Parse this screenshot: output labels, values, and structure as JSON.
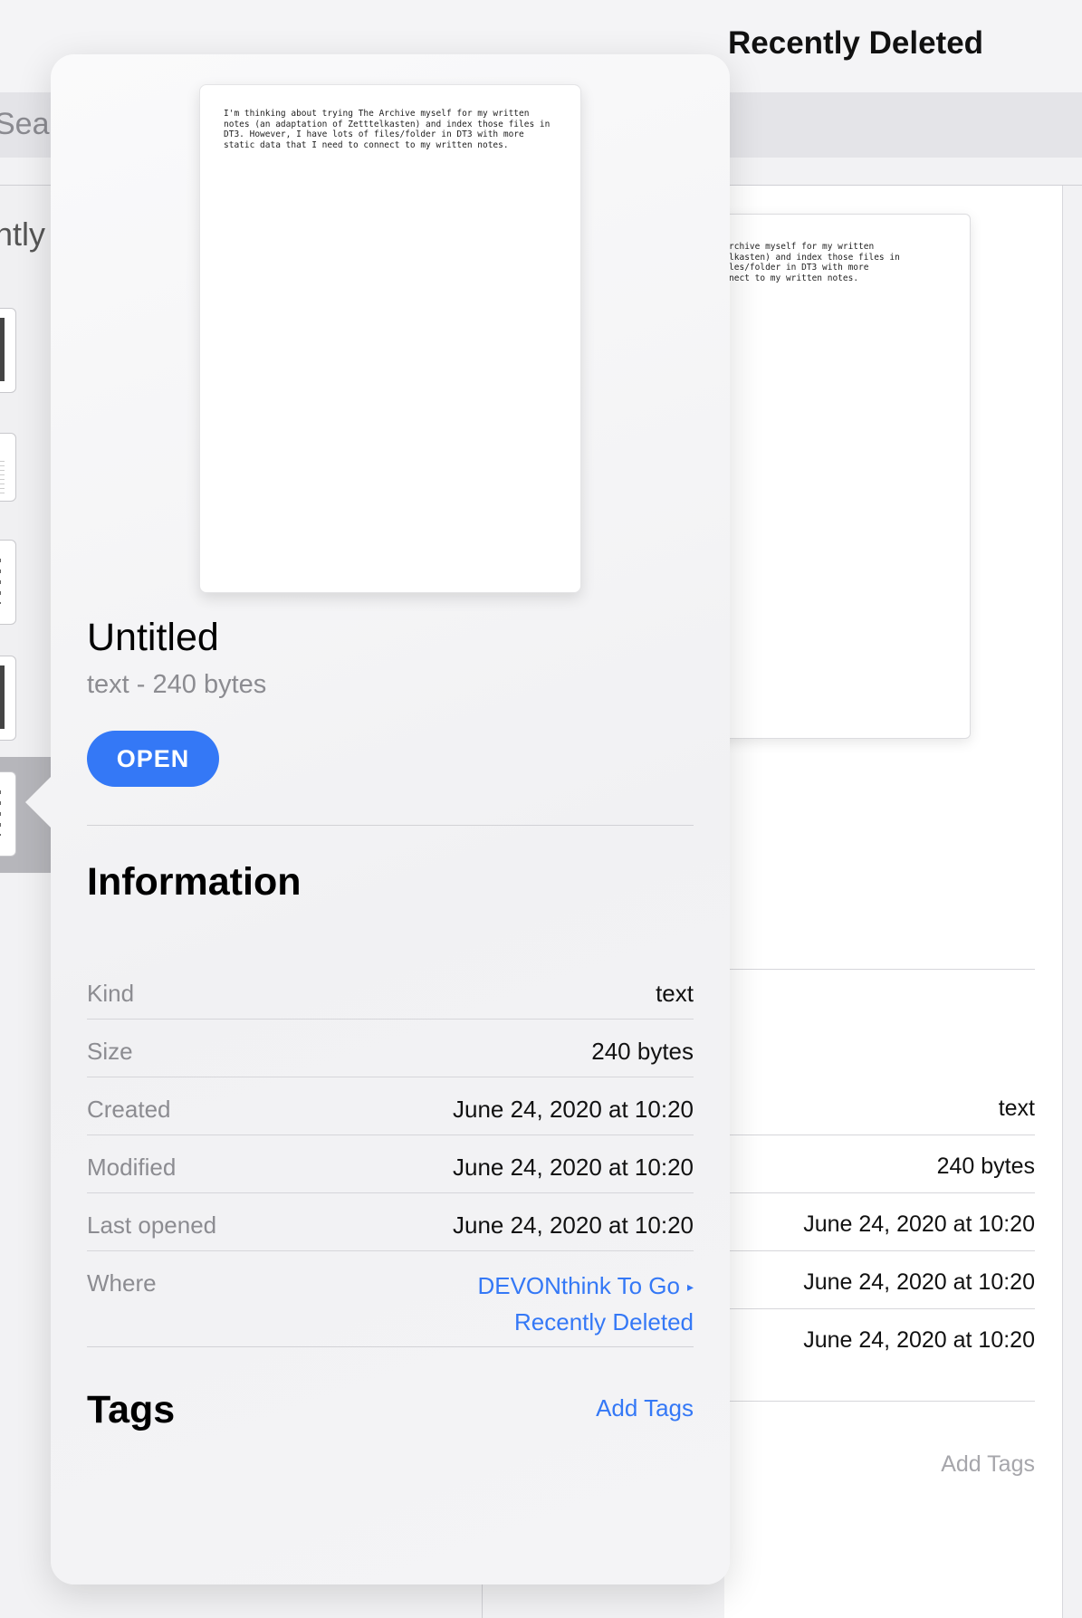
{
  "background": {
    "title": "Recently Deleted",
    "search_placeholder": "Sear",
    "section_label": "ntly (",
    "preview_text": "g The Archive myself for my written\n Zetttelkasten) and index those files in\ns of files/folder in DT3 with more\n to connect to my written notes.",
    "info_values": [
      "text",
      "240 bytes",
      "June 24, 2020 at 10:20",
      "June 24, 2020 at 10:20",
      "June 24, 2020 at 10:20"
    ],
    "add_tags": "Add Tags"
  },
  "popover": {
    "preview_text": "I'm thinking about trying The Archive myself for my written\nnotes (an adaptation of Zetttelkasten) and index those files in\nDT3. However, I have lots of files/folder in DT3 with more\nstatic data that I need to connect to my written notes.",
    "title": "Untitled",
    "subtitle": "text - 240 bytes",
    "open_label": "OPEN",
    "information_heading": "Information",
    "info": {
      "kind_label": "Kind",
      "kind_value": "text",
      "size_label": "Size",
      "size_value": "240 bytes",
      "created_label": "Created",
      "created_value": "June 24, 2020 at 10:20",
      "modified_label": "Modified",
      "modified_value": "June 24, 2020 at 10:20",
      "last_opened_label": "Last opened",
      "last_opened_value": "June 24, 2020 at 10:20",
      "where_label": "Where",
      "where_path_1": "DEVONthink To Go",
      "where_path_2": "Recently Deleted"
    },
    "tags_heading": "Tags",
    "add_tags_label": "Add Tags"
  },
  "colors": {
    "accent": "#3478f6",
    "secondary_text": "#8c8c91",
    "disabled_text": "#a6a6ab"
  },
  "icons": {
    "path_separator": "triangle-right-icon"
  }
}
